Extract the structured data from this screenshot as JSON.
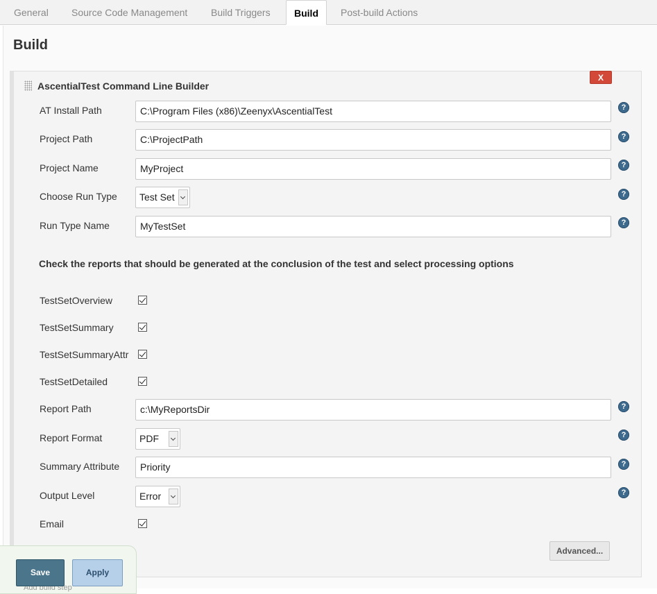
{
  "tabs": [
    {
      "label": "General"
    },
    {
      "label": "Source Code Management"
    },
    {
      "label": "Build Triggers"
    },
    {
      "label": "Build",
      "active": true
    },
    {
      "label": "Post-build Actions"
    }
  ],
  "page": {
    "title": "Build"
  },
  "builder": {
    "title": "AscentialTest Command Line Builder",
    "delete_label": "X",
    "fields": {
      "at_install_path": {
        "label": "AT Install Path",
        "value": "C:\\Program Files (x86)\\Zeenyx\\AscentialTest"
      },
      "project_path": {
        "label": "Project Path",
        "value": "C:\\ProjectPath"
      },
      "project_name": {
        "label": "Project Name",
        "value": "MyProject"
      },
      "run_type": {
        "label": "Choose Run Type",
        "value": "Test Set"
      },
      "run_type_name": {
        "label": "Run Type Name",
        "value": "MyTestSet"
      }
    },
    "reports_heading": "Check the reports that should be generated at the conclusion of the test and select processing options",
    "reports": [
      {
        "label": "TestSetOverview",
        "checked": true
      },
      {
        "label": "TestSetSummary",
        "checked": true
      },
      {
        "label": "TestSetSummaryAttr",
        "checked": true
      },
      {
        "label": "TestSetDetailed",
        "checked": true
      }
    ],
    "report_fields": {
      "report_path": {
        "label": "Report Path",
        "value": "c:\\MyReportsDir"
      },
      "report_format": {
        "label": "Report Format",
        "value": "PDF"
      },
      "summary_attribute": {
        "label": "Summary Attribute",
        "value": "Priority"
      },
      "output_level": {
        "label": "Output Level",
        "value": "Error"
      },
      "email": {
        "label": "Email",
        "checked": true
      }
    },
    "advanced_label": "Advanced...",
    "help_glyph": "?"
  },
  "footer": {
    "save_label": "Save",
    "apply_label": "Apply",
    "add_step_label": "Add build step"
  }
}
